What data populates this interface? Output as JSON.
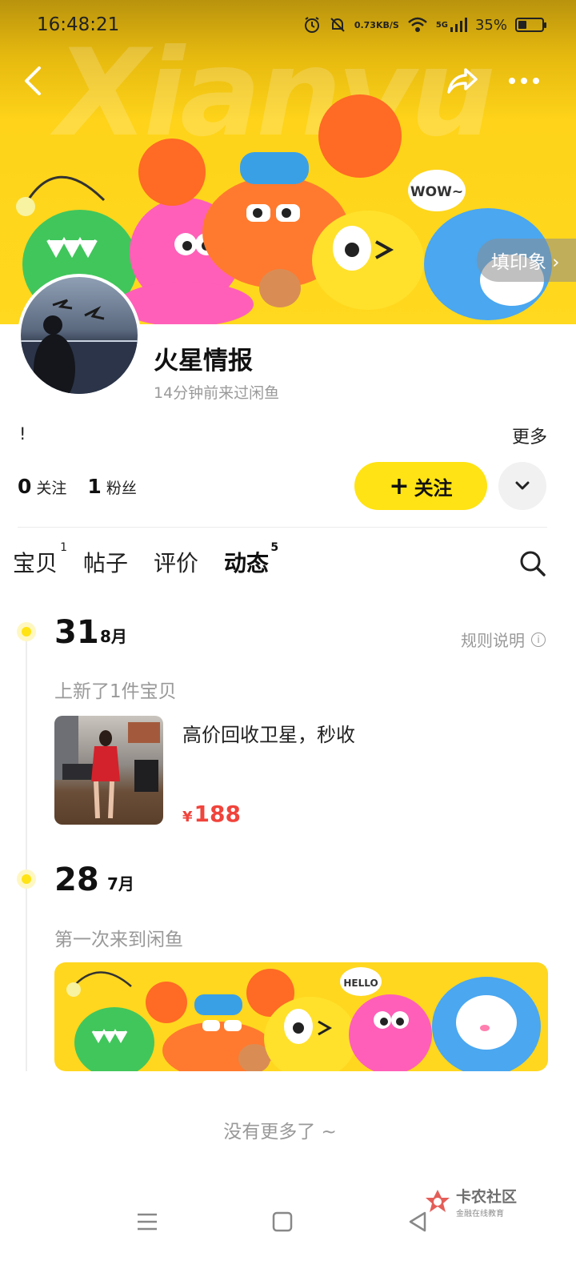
{
  "status_bar": {
    "time": "16:48:21",
    "net_speed_value": "0.73",
    "net_speed_unit": "KB/S",
    "network": "5G",
    "battery_percent": "35%",
    "battery_level": 0.35
  },
  "banner": {
    "watermark": "Xianyu",
    "impression_label": "填印象 ›",
    "bubble_text": "WOW~"
  },
  "profile": {
    "nickname": "火星情报",
    "last_seen": "14分钟前来过闲鱼",
    "bio": "!",
    "more_label": "更多",
    "following_count": "0",
    "following_label": "关注",
    "followers_count": "1",
    "followers_label": "粉丝",
    "follow_button_label": "关注"
  },
  "tabs": [
    {
      "label": "宝贝",
      "count": "1",
      "active": false
    },
    {
      "label": "帖子",
      "count": "",
      "active": false
    },
    {
      "label": "评价",
      "count": "",
      "active": false
    },
    {
      "label": "动态",
      "count": "5",
      "active": true
    }
  ],
  "timeline": {
    "rules_label": "规则说明",
    "entries": [
      {
        "day": "31",
        "month": "8月",
        "event": "上新了1件宝贝",
        "item_title": "高价回收卫星，秒收",
        "price_symbol": "¥",
        "price": "188"
      },
      {
        "day": "28",
        "month": "7月",
        "event": "第一次来到闲鱼",
        "bubble_text": "HELLO"
      }
    ]
  },
  "footer": {
    "no_more": "没有更多了 ~"
  },
  "watermark_logo": {
    "title": "卡农社区",
    "subtitle": "金融在线教育"
  },
  "colors": {
    "accent_yellow": "#ffe314",
    "price_red": "#f0443c",
    "muted_text": "#999999"
  }
}
